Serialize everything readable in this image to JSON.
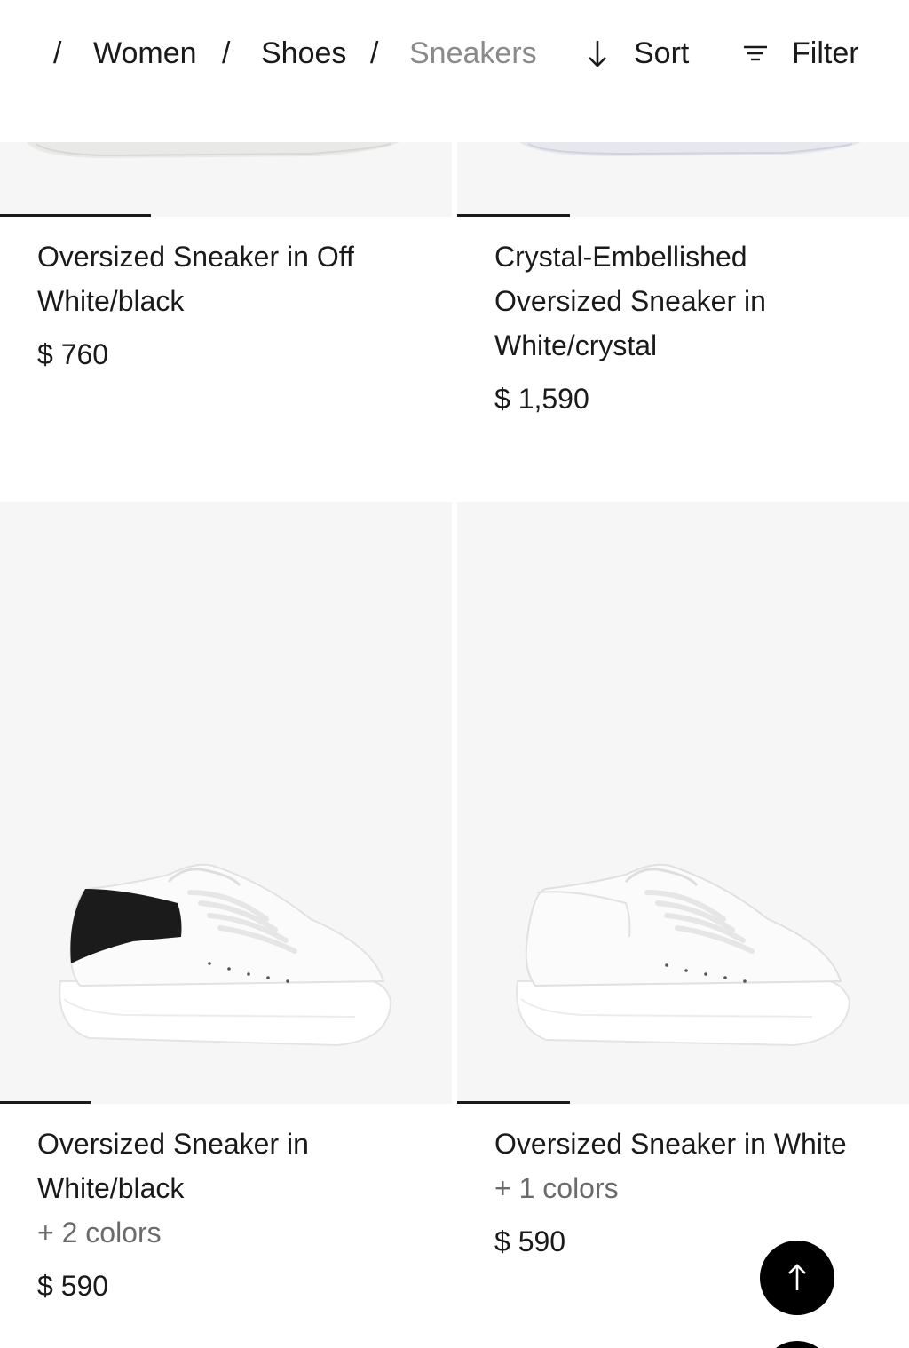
{
  "breadcrumb": {
    "items": [
      {
        "label": "Women"
      },
      {
        "label": "Shoes"
      },
      {
        "label": "Sneakers"
      }
    ],
    "separator": "/"
  },
  "toolbar": {
    "sort_label": "Sort",
    "filter_label": "Filter",
    "sort_icon": "arrow-down-icon",
    "filter_icon": "filter-lines-icon"
  },
  "products": [
    {
      "name_line1": "Oversized Sneaker in Off",
      "name_line2": "White/black",
      "price": "$ 760",
      "carousel_progress": 0.33
    },
    {
      "name_line1": "Crystal-Embellished",
      "name_line2": "Oversized Sneaker in",
      "name_line3": "White/crystal",
      "price": "$ 1,590",
      "carousel_progress": 0.25
    },
    {
      "name_line1": "Oversized Sneaker in",
      "name_line2": "White/black",
      "colors": "+ 2 colors",
      "price": "$ 590",
      "carousel_progress": 0.2
    },
    {
      "name_line1": "Oversized Sneaker in White",
      "colors": "+ 1 colors",
      "price": "$ 590",
      "carousel_progress": 0.25
    }
  ],
  "back_to_top_icon": "arrow-up-icon",
  "colors": {
    "text": "#1a1a1a",
    "muted": "#8a8a8a",
    "tile_bg": "#f6f6f6",
    "accent": "#000000"
  }
}
